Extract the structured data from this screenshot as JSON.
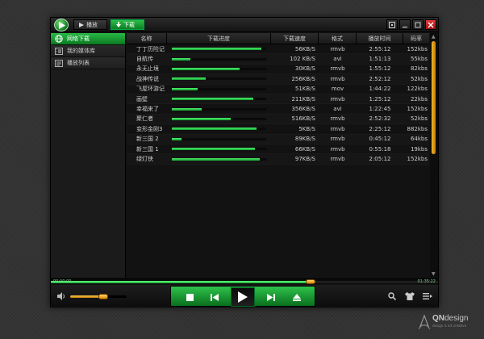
{
  "tabs": [
    {
      "label": "播放",
      "icon": "play-icon",
      "active": false
    },
    {
      "label": "下载",
      "icon": "download-icon",
      "active": true
    }
  ],
  "window_buttons": [
    "mini-mode-icon",
    "minimize-icon",
    "maximize-icon",
    "close-icon"
  ],
  "sidebar": {
    "items": [
      {
        "label": "网络下载",
        "icon": "globe-icon",
        "active": true
      },
      {
        "label": "我的媒体库",
        "icon": "film-icon",
        "active": false
      },
      {
        "label": "播放列表",
        "icon": "list-icon",
        "active": false
      }
    ]
  },
  "list": {
    "columns": [
      "名称",
      "下载进度",
      "下载速度",
      "格式",
      "播放时间",
      "码率"
    ],
    "rows": [
      {
        "name": "丁丁历险记",
        "progress": 0.95,
        "speed": "56KB/S",
        "format": "rmvb",
        "time": "2:55:12",
        "rate": "152kbs"
      },
      {
        "name": "自航传",
        "progress": 0.2,
        "speed": "102 KB/S",
        "format": "avi",
        "time": "1:51:13",
        "rate": "55kbs"
      },
      {
        "name": "永无止境",
        "progress": 0.72,
        "speed": "30KB/S",
        "format": "rmvb",
        "time": "1:55:12",
        "rate": "82kbs"
      },
      {
        "name": "战神传说",
        "progress": 0.36,
        "speed": "256KB/S",
        "format": "rmvb",
        "time": "2:52:12",
        "rate": "52kbs"
      },
      {
        "name": "飞屋环游记",
        "progress": 0.27,
        "speed": "51KB/S",
        "format": "mov",
        "time": "1:44:22",
        "rate": "122kbs"
      },
      {
        "name": "画壁",
        "progress": 0.86,
        "speed": "211KB/S",
        "format": "rmvb",
        "time": "1:25:12",
        "rate": "22kbs"
      },
      {
        "name": "幸福来了",
        "progress": 0.32,
        "speed": "356KB/S",
        "format": "avi",
        "time": "1:22:45",
        "rate": "152kbs"
      },
      {
        "name": "聚仁者",
        "progress": 0.62,
        "speed": "516KB/S",
        "format": "rmvb",
        "time": "2:52:32",
        "rate": "52kbs"
      },
      {
        "name": "变形金刚3",
        "progress": 0.9,
        "speed": "5KB/S",
        "format": "rmvb",
        "time": "2:25:12",
        "rate": "882kbs"
      },
      {
        "name": "新三国 2",
        "progress": 0.1,
        "speed": "89KB/S",
        "format": "rmvb",
        "time": "0:45:12",
        "rate": "64kbs"
      },
      {
        "name": "新三国 1",
        "progress": 0.88,
        "speed": "66KB/S",
        "format": "rmvb",
        "time": "0:55:18",
        "rate": "19kbs"
      },
      {
        "name": "绿灯侠",
        "progress": 0.93,
        "speed": "97KB/S",
        "format": "rmvb",
        "time": "2:05:12",
        "rate": "152kbs"
      }
    ]
  },
  "seek": {
    "time_elapsed": "00:00:00",
    "time_total": "01:35:22",
    "position": 0.67
  },
  "volume": {
    "level": 0.58
  },
  "controls": [
    "stop-icon",
    "prev-icon",
    "play-icon",
    "next-icon",
    "eject-icon"
  ],
  "right_controls": [
    "search-icon",
    "skin-icon",
    "menu-icon"
  ],
  "watermark": {
    "brand_a": "QN",
    "brand_b": "design",
    "tagline": "design is art creative"
  },
  "colors": {
    "accent_green": "#1faa3a",
    "accent_orange": "#e19b12",
    "close_red": "#c62424"
  }
}
